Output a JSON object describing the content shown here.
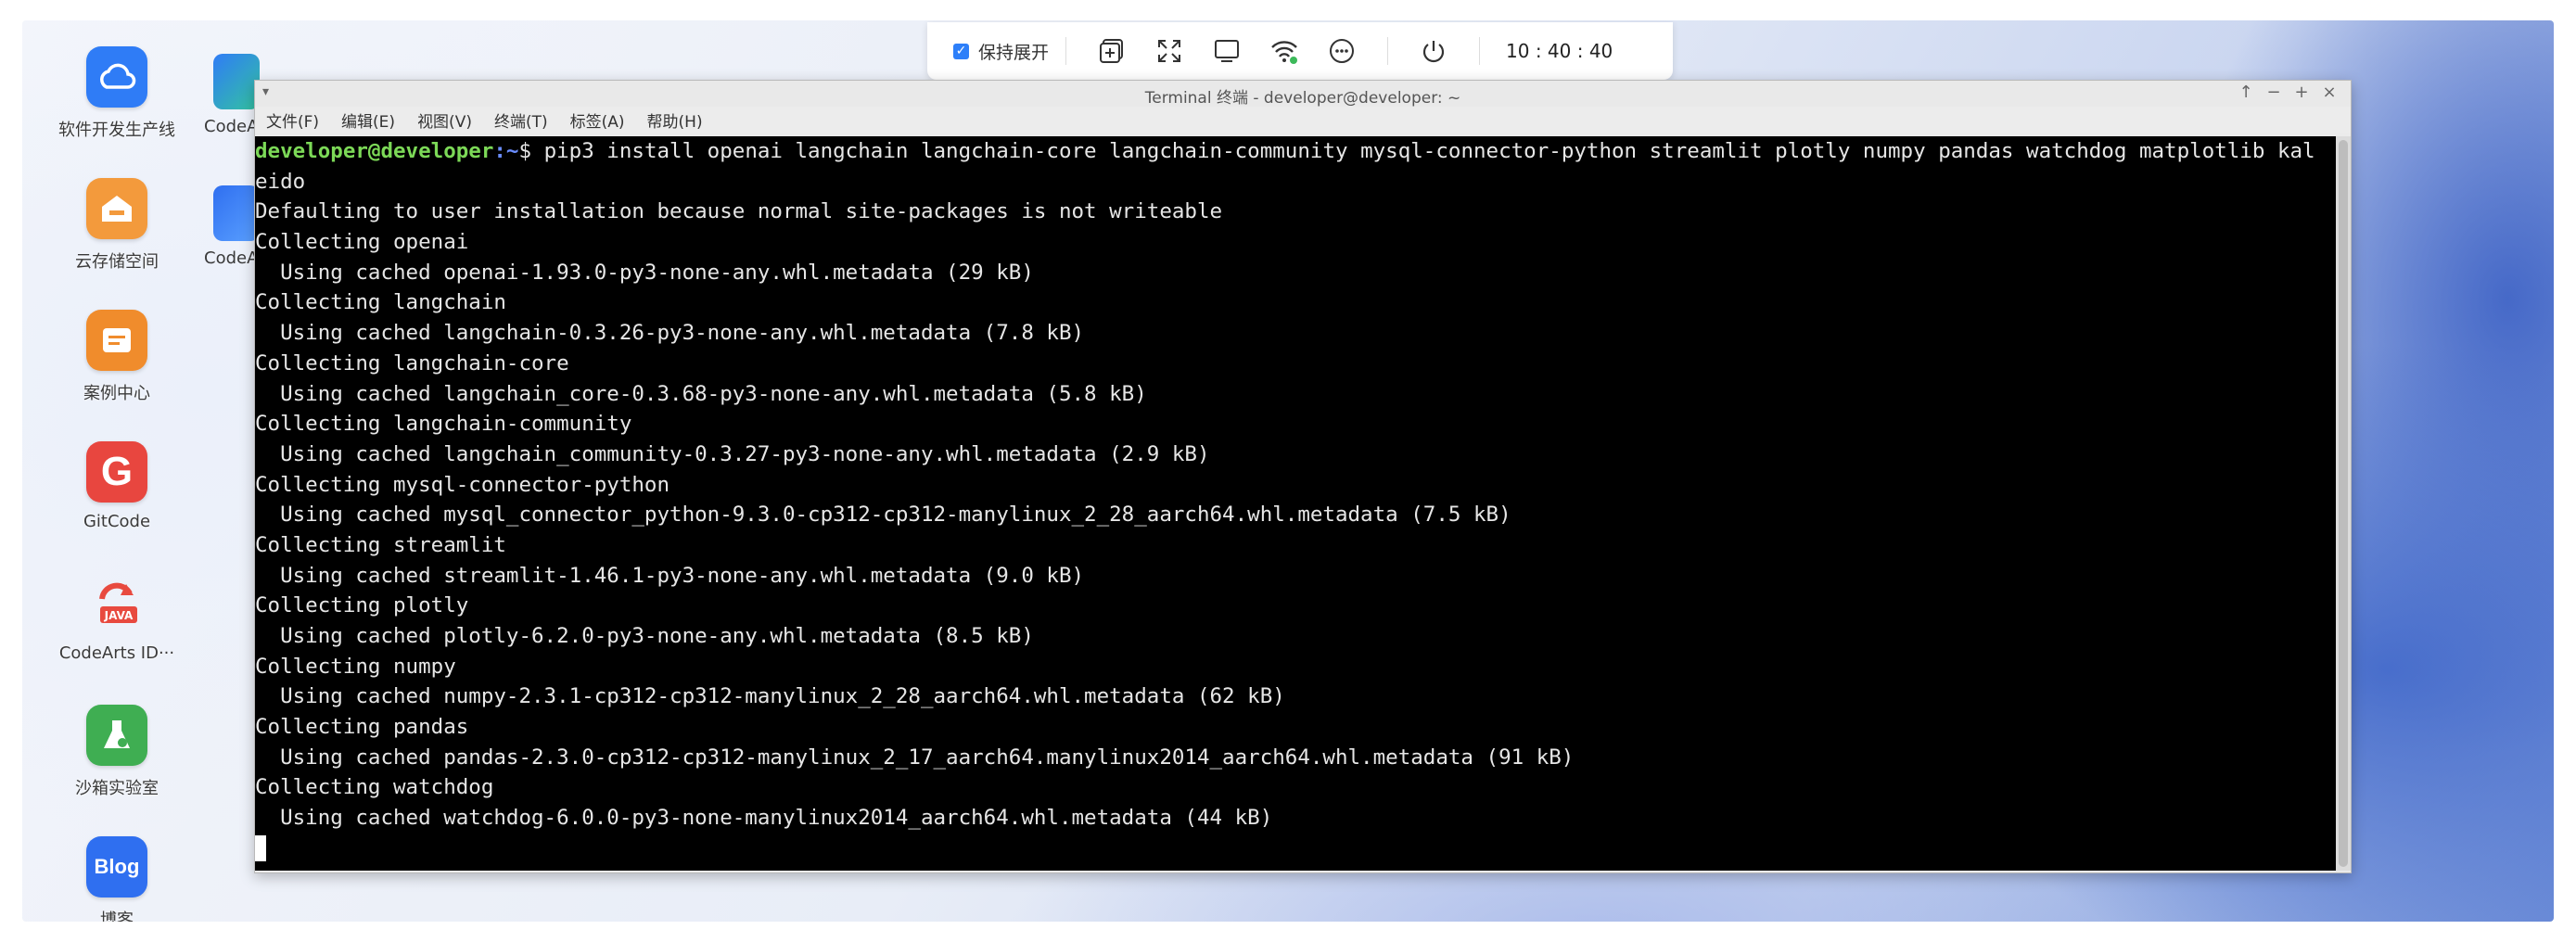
{
  "desktop": {
    "icons": [
      {
        "label": "软件开发生产线",
        "glyph": "☁",
        "color": "#2f7cf6"
      },
      {
        "label": "云存储空间",
        "glyph": "⛁",
        "color": "#f39a3c"
      },
      {
        "label": "案例中心",
        "glyph": "▤",
        "color": "#f08c2c"
      },
      {
        "label": "GitCode",
        "glyph": "G",
        "color": "#e8463f"
      },
      {
        "label": "CodeArts ID···",
        "glyph": "JAVA",
        "color": "#e84a3f"
      },
      {
        "label": "沙箱实验室",
        "glyph": "⚗",
        "color": "#3fae52"
      },
      {
        "label": "博客",
        "glyph": "Blog",
        "color": "#2f6ff0"
      }
    ],
    "partial_icons": [
      {
        "label": "CodeArts"
      },
      {
        "label": "CodeArts"
      }
    ]
  },
  "toolbar": {
    "keep_expanded_label": "保持展开",
    "keep_expanded_checked": true,
    "icons": [
      "add-window-icon",
      "fullscreen-icon",
      "screen-icon",
      "wifi-icon",
      "more-icon",
      "power-icon"
    ],
    "time": "10 : 40 : 40"
  },
  "window": {
    "title": "Terminal 终端 - developer@developer: ~",
    "menu": [
      "文件(F)",
      "编辑(E)",
      "视图(V)",
      "终端(T)",
      "标签(A)",
      "帮助(H)"
    ],
    "controls": [
      "↑",
      "−",
      "+",
      "×"
    ]
  },
  "terminal": {
    "prompt_user": "developer@developer",
    "prompt_path": ":~",
    "prompt_symbol": "$ ",
    "command": "pip3 install openai langchain langchain-core langchain-community mysql-connector-python streamlit plotly numpy pandas watchdog matplotlib kal",
    "lines": [
      "eido",
      "Defaulting to user installation because normal site-packages is not writeable",
      "Collecting openai",
      "  Using cached openai-1.93.0-py3-none-any.whl.metadata (29 kB)",
      "Collecting langchain",
      "  Using cached langchain-0.3.26-py3-none-any.whl.metadata (7.8 kB)",
      "Collecting langchain-core",
      "  Using cached langchain_core-0.3.68-py3-none-any.whl.metadata (5.8 kB)",
      "Collecting langchain-community",
      "  Using cached langchain_community-0.3.27-py3-none-any.whl.metadata (2.9 kB)",
      "Collecting mysql-connector-python",
      "  Using cached mysql_connector_python-9.3.0-cp312-cp312-manylinux_2_28_aarch64.whl.metadata (7.5 kB)",
      "Collecting streamlit",
      "  Using cached streamlit-1.46.1-py3-none-any.whl.metadata (9.0 kB)",
      "Collecting plotly",
      "  Using cached plotly-6.2.0-py3-none-any.whl.metadata (8.5 kB)",
      "Collecting numpy",
      "  Using cached numpy-2.3.1-cp312-cp312-manylinux_2_28_aarch64.whl.metadata (62 kB)",
      "Collecting pandas",
      "  Using cached pandas-2.3.0-cp312-cp312-manylinux_2_17_aarch64.manylinux2014_aarch64.whl.metadata (91 kB)",
      "Collecting watchdog",
      "  Using cached watchdog-6.0.0-py3-none-manylinux2014_aarch64.whl.metadata (44 kB)"
    ]
  }
}
